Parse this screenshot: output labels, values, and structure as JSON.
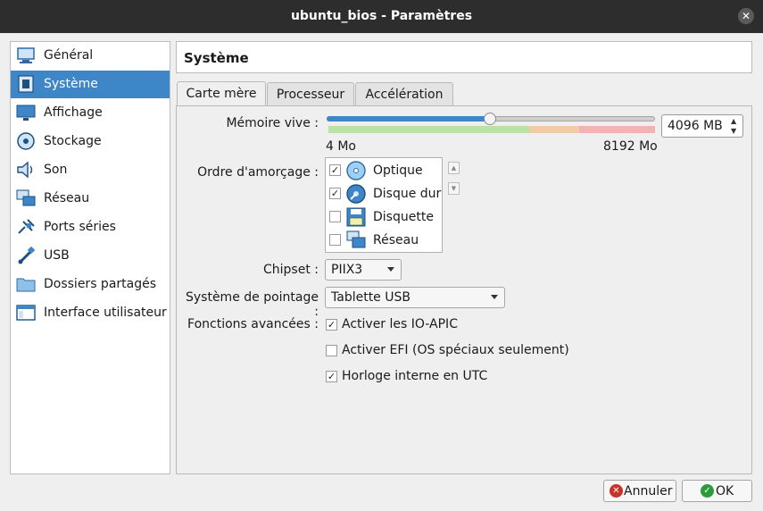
{
  "window": {
    "title": "ubuntu_bios - Paramètres"
  },
  "sidebar": {
    "items": [
      {
        "label": "Général",
        "icon": "monitor-general-icon"
      },
      {
        "label": "Système",
        "icon": "chip-icon",
        "active": true
      },
      {
        "label": "Affichage",
        "icon": "display-icon"
      },
      {
        "label": "Stockage",
        "icon": "disk-icon"
      },
      {
        "label": "Son",
        "icon": "speaker-icon"
      },
      {
        "label": "Réseau",
        "icon": "network-icon"
      },
      {
        "label": "Ports séries",
        "icon": "serial-port-icon"
      },
      {
        "label": "USB",
        "icon": "usb-icon"
      },
      {
        "label": "Dossiers partagés",
        "icon": "folder-icon"
      },
      {
        "label": "Interface utilisateur",
        "icon": "window-ui-icon"
      }
    ]
  },
  "header": {
    "title": "Système"
  },
  "tabs": [
    {
      "label": "Carte mère",
      "active": true
    },
    {
      "label": "Processeur"
    },
    {
      "label": "Accélération"
    }
  ],
  "memory": {
    "label": "Mémoire vive :",
    "value": "4096 MB",
    "fraction": 0.5,
    "min_label": "4 Mo",
    "max_label": "8192 Mo"
  },
  "boot": {
    "label": "Ordre d'amorçage :",
    "items": [
      {
        "label": "Optique",
        "checked": true,
        "icon": "optical-disc-icon"
      },
      {
        "label": "Disque dur",
        "checked": true,
        "icon": "hard-disk-icon"
      },
      {
        "label": "Disquette",
        "checked": false,
        "icon": "floppy-icon"
      },
      {
        "label": "Réseau",
        "checked": false,
        "icon": "network-boot-icon"
      }
    ]
  },
  "chipset": {
    "label": "Chipset :",
    "value": "PIIX3"
  },
  "pointing": {
    "label": "Système de pointage :",
    "value": "Tablette USB"
  },
  "advanced": {
    "label": "Fonctions avancées :",
    "options": [
      {
        "label": "Activer les IO-APIC",
        "checked": true
      },
      {
        "label": "Activer EFI (OS spéciaux seulement)",
        "checked": false
      },
      {
        "label": "Horloge interne en UTC",
        "checked": true
      }
    ]
  },
  "buttons": {
    "cancel": "Annuler",
    "ok": "OK"
  },
  "colors": {
    "accent": "#3e86c8",
    "titlebar": "#2d2d2d",
    "ok_icon": "#2e9a3d",
    "cancel_icon": "#c8322b"
  }
}
